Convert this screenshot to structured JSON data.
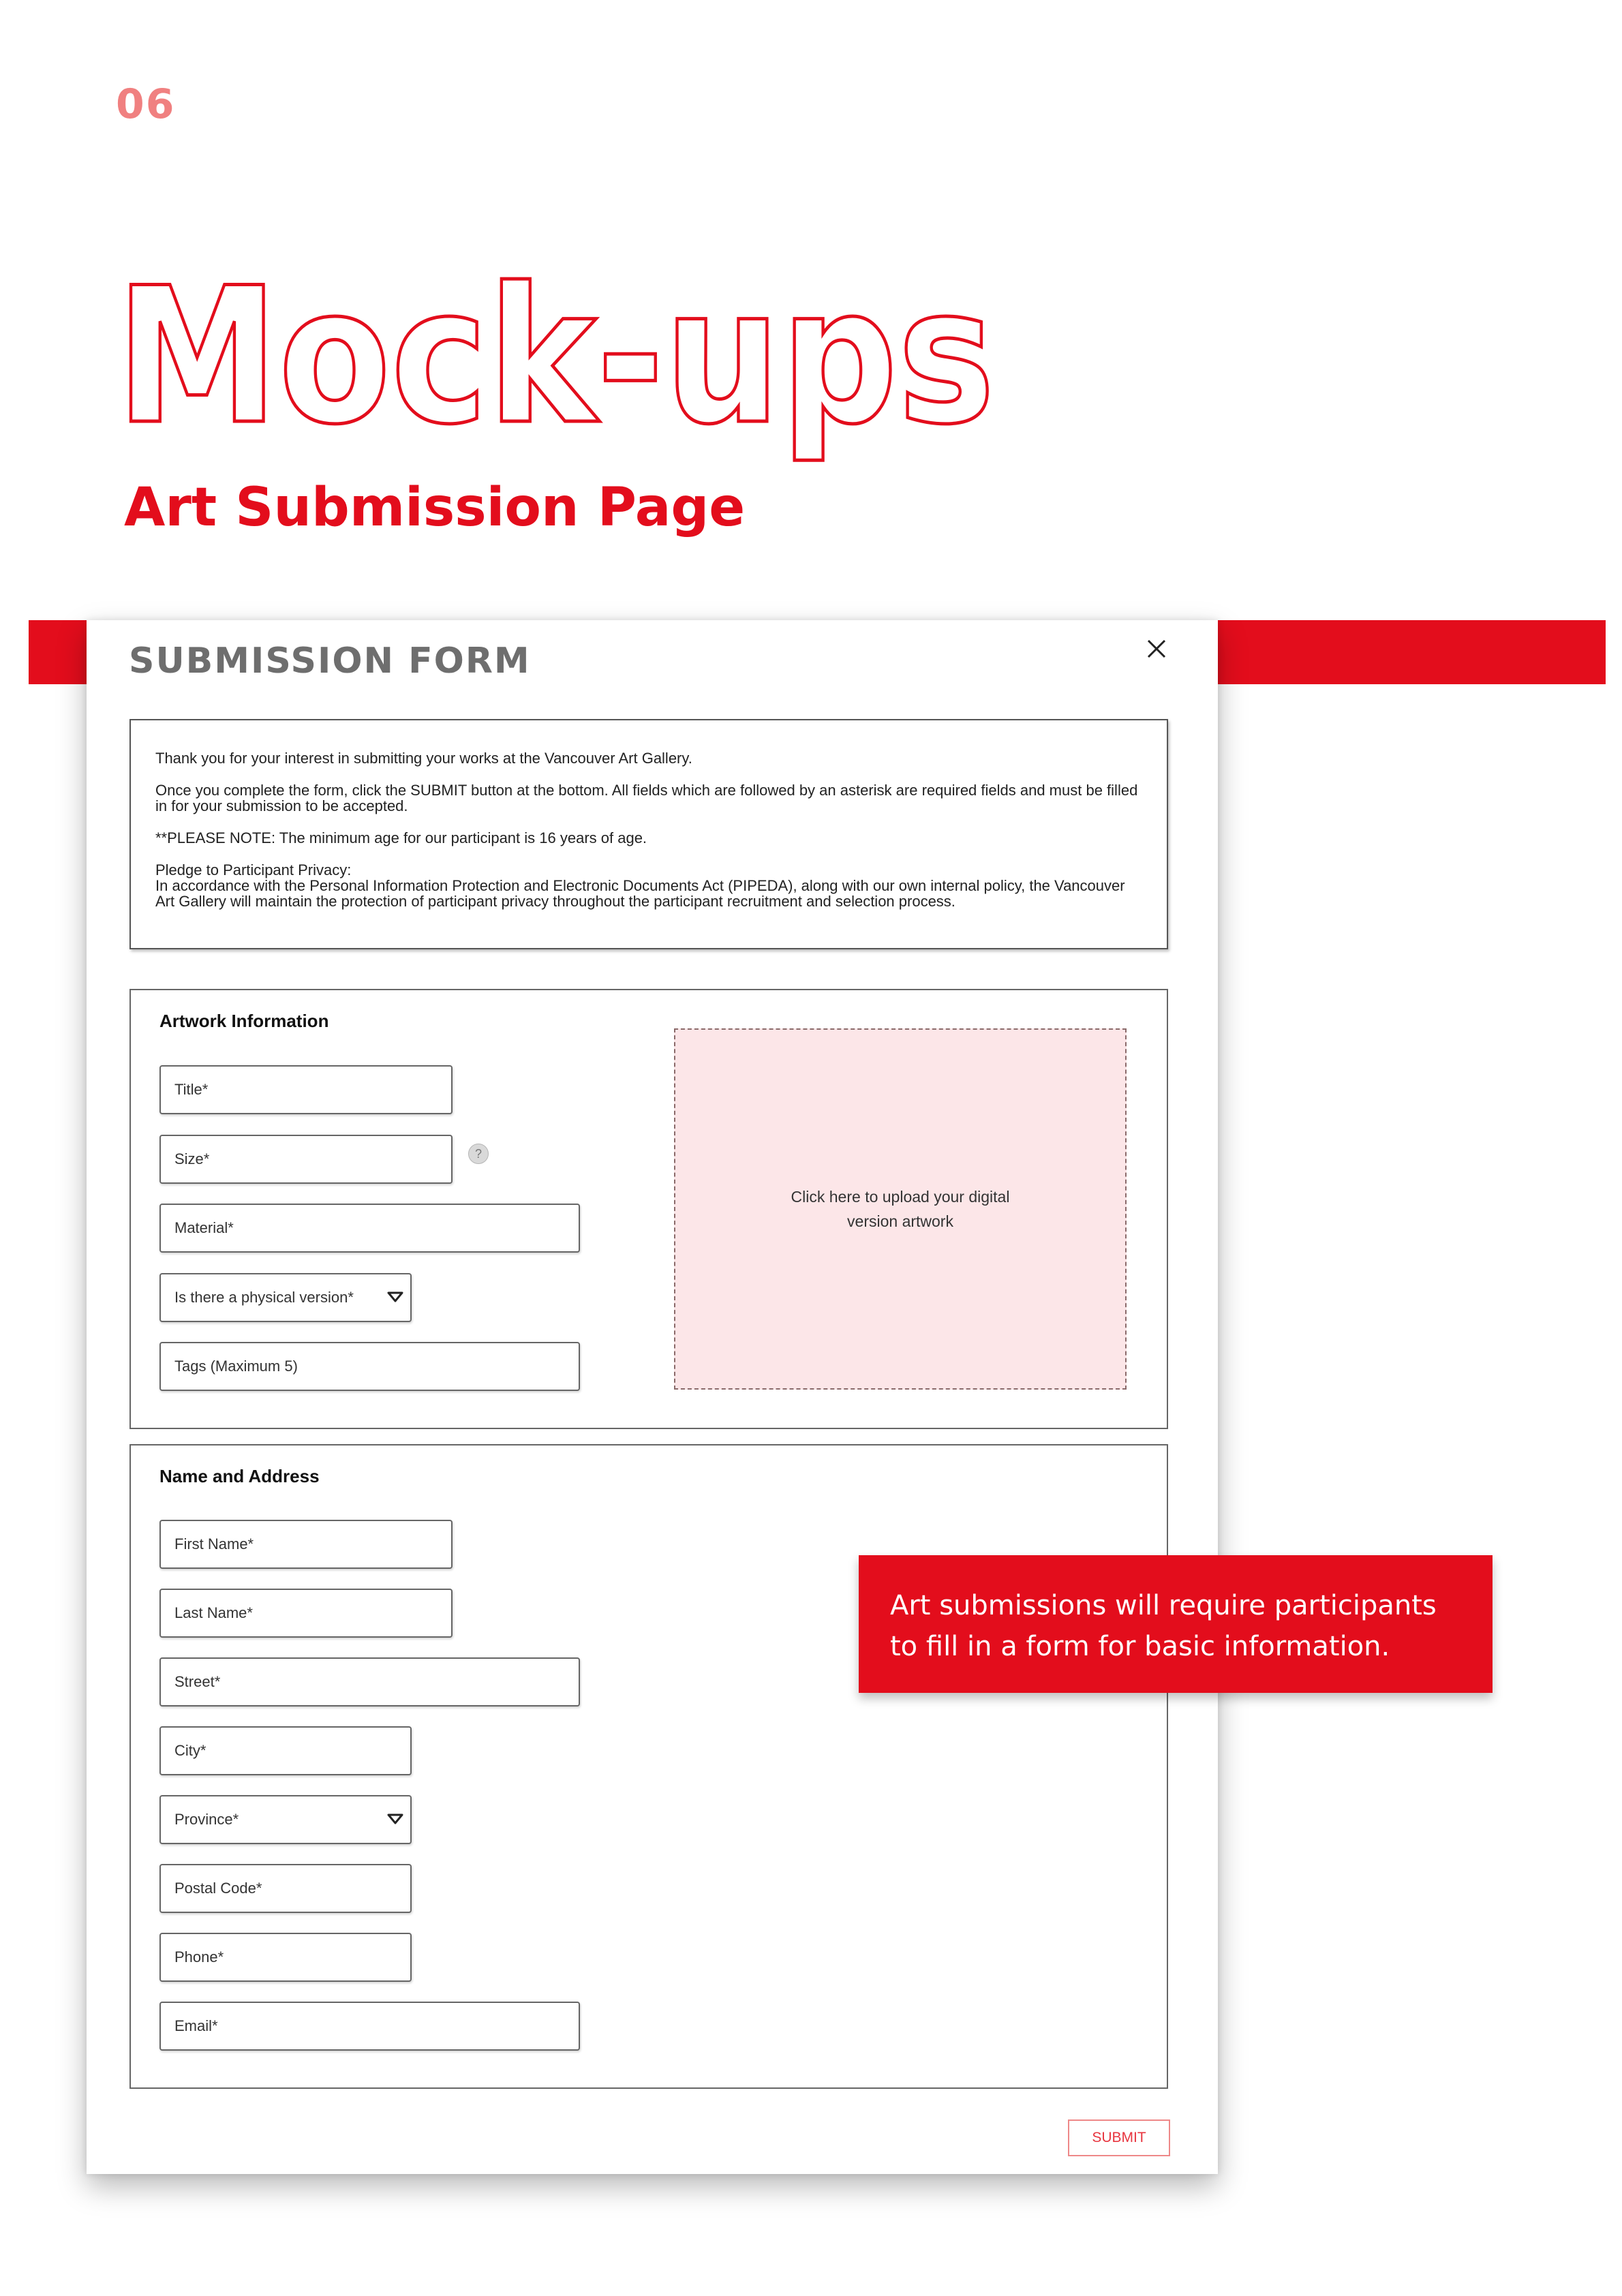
{
  "page_number": "06",
  "heading": "Mock-ups",
  "subheading": "Art Submission Page",
  "accent_color": "#e30d1c",
  "form": {
    "title": "SUBMISSION  FORM",
    "close_icon": "close-icon",
    "intro": {
      "thanks": "Thank you for your interest in submitting your works at the Vancouver Art Gallery.",
      "instructions": "Once you complete the form, click the SUBMIT button at the bottom. All fields which are followed by an asterisk are required fields and must be filled in for your submission to be accepted.",
      "age_note": "**PLEASE NOTE: The minimum age for our participant is 16 years of age.",
      "privacy_heading": "Pledge to Participant Privacy:",
      "privacy_text": "In accordance with the Personal Information Protection and Electronic Documents Act (PIPEDA), along with our own internal policy, the Vancouver Art Gallery will maintain the protection of participant privacy throughout the participant recruitment and selection process."
    },
    "artwork": {
      "title": "Artwork  Information",
      "fields": {
        "title": "Title*",
        "size": "Size*",
        "material": "Material*",
        "physical_version": "Is there a physical version*",
        "tags": "Tags (Maximum 5)"
      },
      "help_icon_label": "?",
      "upload_text": "Click here to upload your digital\nversion artwork"
    },
    "name_address": {
      "title": "Name  and  Address",
      "fields": {
        "first_name": "First Name*",
        "last_name": "Last Name*",
        "street": "Street*",
        "city": "City*",
        "province": "Province*",
        "postal_code": "Postal Code*",
        "phone": "Phone*",
        "email": "Email*"
      }
    },
    "submit_label": "SUBMIT"
  },
  "callout": "Art submissions will require participants to fill in a form for basic information."
}
